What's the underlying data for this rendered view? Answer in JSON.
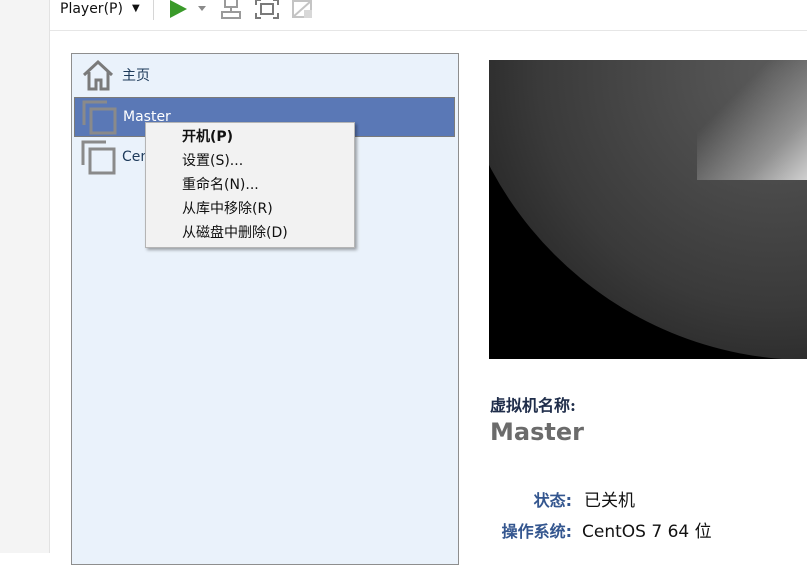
{
  "toolbar": {
    "player_label": "Player(P)"
  },
  "icons": {
    "play": "play-icon",
    "dropdown": "chevron-down-icon",
    "send_keys": "send-ctrl-alt-del-icon",
    "fullscreen": "fullscreen-icon",
    "unity": "unity-icon"
  },
  "library": {
    "items": [
      {
        "label": "主页",
        "icon": "home-icon"
      },
      {
        "label": "Master",
        "icon": "vm-icon",
        "selected": true
      },
      {
        "label": "Cent",
        "icon": "vm-icon"
      }
    ]
  },
  "context_menu": {
    "items": [
      {
        "label": "开机(P)",
        "bold": true
      },
      {
        "label": "设置(S)..."
      },
      {
        "label": "重命名(N)..."
      },
      {
        "label": "从库中移除(R)"
      },
      {
        "label": "从磁盘中删除(D)"
      }
    ]
  },
  "details": {
    "name_label": "虚拟机名称:",
    "name": "Master",
    "state_label": "状态:",
    "state_value": "已关机",
    "os_label": "操作系统:",
    "os_value": "CentOS 7 64 位"
  },
  "colors": {
    "selection": "#5a78b6",
    "library_bg": "#eaf2fb",
    "accent_label": "#34568f",
    "play_green": "#3a9a2a"
  }
}
